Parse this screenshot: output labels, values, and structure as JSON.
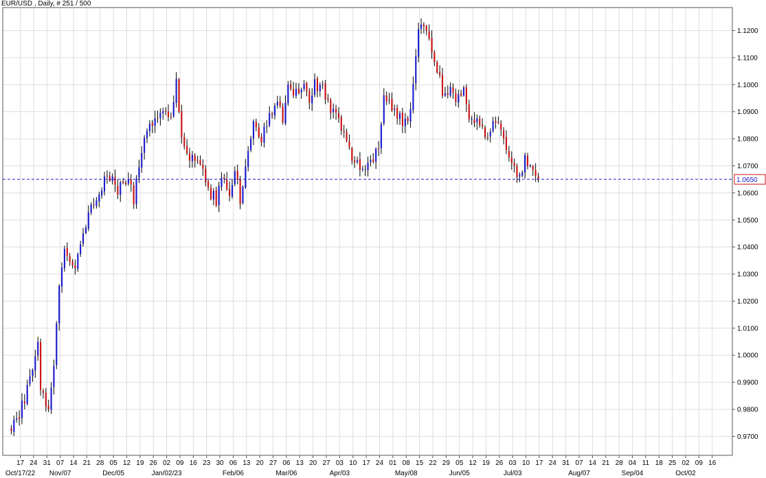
{
  "title": "EUR/USD , Daily, # 251 / 500",
  "chart_data": {
    "type": "candlestick",
    "symbol": "EUR/USD",
    "timeframe": "Daily",
    "bar_count_label": "# 251 / 500",
    "ylim": [
      0.963,
      1.1285
    ],
    "y_ticks": [
      "1.1200",
      "1.1100",
      "1.1000",
      "1.0900",
      "1.0800",
      "1.0700",
      "1.0600",
      "1.0500",
      "1.0400",
      "1.0300",
      "1.0200",
      "1.0100",
      "1.0000",
      "0.9900",
      "0.9800",
      "0.9700"
    ],
    "x_ticks": [
      "17",
      "24",
      "31",
      "07",
      "14",
      "21",
      "28",
      "05",
      "12",
      "19",
      "26",
      "02",
      "09",
      "16",
      "23",
      "30",
      "06",
      "13",
      "20",
      "27",
      "06",
      "13",
      "20",
      "27",
      "03",
      "10",
      "17",
      "24",
      "01",
      "08",
      "15",
      "22",
      "29",
      "05",
      "12",
      "19",
      "26",
      "03",
      "10",
      "17",
      "24",
      "31",
      "07",
      "14",
      "21",
      "28",
      "04",
      "11",
      "18",
      "25",
      "02",
      "09",
      "16"
    ],
    "x_month_labels": [
      {
        "label": "Oct/17/22",
        "tick": 0
      },
      {
        "label": "Nov/07",
        "tick": 3
      },
      {
        "label": "Dec/05",
        "tick": 7
      },
      {
        "label": "Jan/02/23",
        "tick": 11
      },
      {
        "label": "Feb/06",
        "tick": 16
      },
      {
        "label": "Mar/06",
        "tick": 20
      },
      {
        "label": "Apr/03",
        "tick": 24
      },
      {
        "label": "May/08",
        "tick": 29
      },
      {
        "label": "Jun/05",
        "tick": 33
      },
      {
        "label": "Jul/03",
        "tick": 37
      },
      {
        "label": "Aug/07",
        "tick": 42
      },
      {
        "label": "Sep/04",
        "tick": 46
      },
      {
        "label": "Oct/02",
        "tick": 50
      }
    ],
    "current_price": "1.0650",
    "current_price_value": 1.065,
    "grid": true,
    "colors": {
      "up": "#1a1acc",
      "down": "#cc1111",
      "wick": "#000000",
      "current_line": "#1a1acc",
      "current_box": "#cc1111",
      "grid": "#dddddd"
    },
    "anchors": [
      [
        0,
        0.972
      ],
      [
        3,
        0.978
      ],
      [
        6,
        0.987
      ],
      [
        10,
        1.006
      ],
      [
        11,
        0.988
      ],
      [
        14,
        0.978
      ],
      [
        16,
        0.998
      ],
      [
        18,
        1.025
      ],
      [
        20,
        1.04
      ],
      [
        24,
        1.033
      ],
      [
        28,
        1.048
      ],
      [
        30,
        1.054
      ],
      [
        34,
        1.063
      ],
      [
        36,
        1.068
      ],
      [
        40,
        1.06
      ],
      [
        44,
        1.067
      ],
      [
        46,
        1.058
      ],
      [
        48,
        1.07
      ],
      [
        51,
        1.083
      ],
      [
        54,
        1.087
      ],
      [
        58,
        1.092
      ],
      [
        60,
        1.088
      ],
      [
        62,
        1.1
      ],
      [
        64,
        1.08
      ],
      [
        67,
        1.072
      ],
      [
        70,
        1.072
      ],
      [
        73,
        1.066
      ],
      [
        75,
        1.06
      ],
      [
        77,
        1.057
      ],
      [
        79,
        1.066
      ],
      [
        82,
        1.057
      ],
      [
        84,
        1.068
      ],
      [
        86,
        1.058
      ],
      [
        88,
        1.07
      ],
      [
        91,
        1.085
      ],
      [
        94,
        1.08
      ],
      [
        97,
        1.088
      ],
      [
        100,
        1.095
      ],
      [
        102,
        1.087
      ],
      [
        104,
        1.098
      ],
      [
        106,
        1.095
      ],
      [
        110,
        1.1
      ],
      [
        112,
        1.094
      ],
      [
        114,
        1.1
      ],
      [
        117,
        1.099
      ],
      [
        120,
        1.091
      ],
      [
        123,
        1.086
      ],
      [
        126,
        1.078
      ],
      [
        129,
        1.072
      ],
      [
        132,
        1.07
      ],
      [
        134,
        1.072
      ],
      [
        136,
        1.072
      ],
      [
        138,
        1.078
      ],
      [
        140,
        1.094
      ],
      [
        142,
        1.094
      ],
      [
        144,
        1.09
      ],
      [
        147,
        1.086
      ],
      [
        149,
        1.086
      ],
      [
        151,
        1.1
      ],
      [
        153,
        1.12
      ],
      [
        155,
        1.123
      ],
      [
        156,
        1.122
      ],
      [
        158,
        1.113
      ],
      [
        160,
        1.105
      ],
      [
        162,
        1.098
      ],
      [
        165,
        1.098
      ],
      [
        167,
        1.094
      ],
      [
        170,
        1.097
      ],
      [
        172,
        1.088
      ],
      [
        175,
        1.087
      ],
      [
        177,
        1.084
      ],
      [
        179,
        1.08
      ],
      [
        181,
        1.087
      ],
      [
        183,
        1.088
      ],
      [
        185,
        1.079
      ],
      [
        187,
        1.073
      ],
      [
        189,
        1.071
      ],
      [
        191,
        1.065
      ],
      [
        193,
        1.074
      ],
      [
        195,
        1.069
      ],
      [
        196,
        1.068
      ],
      [
        197,
        1.066
      ],
      [
        198,
        1.065
      ]
    ]
  }
}
